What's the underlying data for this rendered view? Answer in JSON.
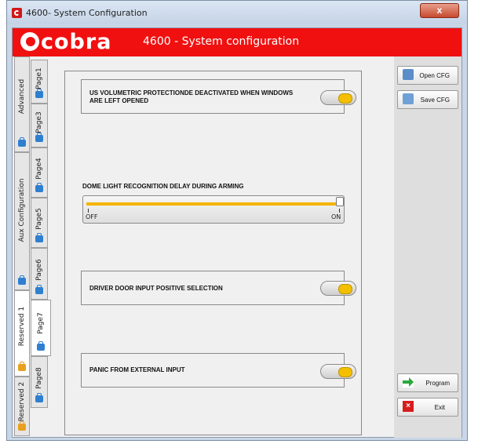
{
  "window": {
    "title": "4600- System Configuration",
    "close_glyph": "x"
  },
  "header": {
    "logo_text": "cobra",
    "title": "4600 - System configuration",
    "accent": "#f01010"
  },
  "tabs_outer": [
    {
      "label": "Advanced",
      "icon": "suitcase-icon"
    },
    {
      "label": "Aux Configuration",
      "icon": "suitcase-icon"
    },
    {
      "label": "Reserved 1",
      "icon": "lock-icon"
    },
    {
      "label": "Reserved 2",
      "icon": "lock-icon"
    }
  ],
  "tabs_inner": [
    {
      "label": "Page1"
    },
    {
      "label": "Page3"
    },
    {
      "label": "Page4"
    },
    {
      "label": "Page5"
    },
    {
      "label": "Page6"
    },
    {
      "label": "Page7"
    },
    {
      "label": "Page8"
    }
  ],
  "options": {
    "us_volumetric": {
      "label": "US VOLUMETRIC PROTECTIONDE DEACTIVATED WHEN WINDOWS ARE LEFT OPENED",
      "state": "on"
    },
    "dome_light": {
      "label": "DOME LIGHT RECOGNITION DELAY DURING ARMING",
      "min_label": "OFF",
      "max_label": "ON",
      "value": 1.0
    },
    "driver_door": {
      "label": "DRIVER DOOR INPUT POSITIVE SELECTION",
      "state": "on"
    },
    "panic": {
      "label": "PANIC FROM EXTERNAL INPUT",
      "state": "on"
    }
  },
  "actions": {
    "open_cfg": "Open CFG",
    "save_cfg": "Save CFG",
    "program": "Program",
    "exit": "Exit"
  }
}
